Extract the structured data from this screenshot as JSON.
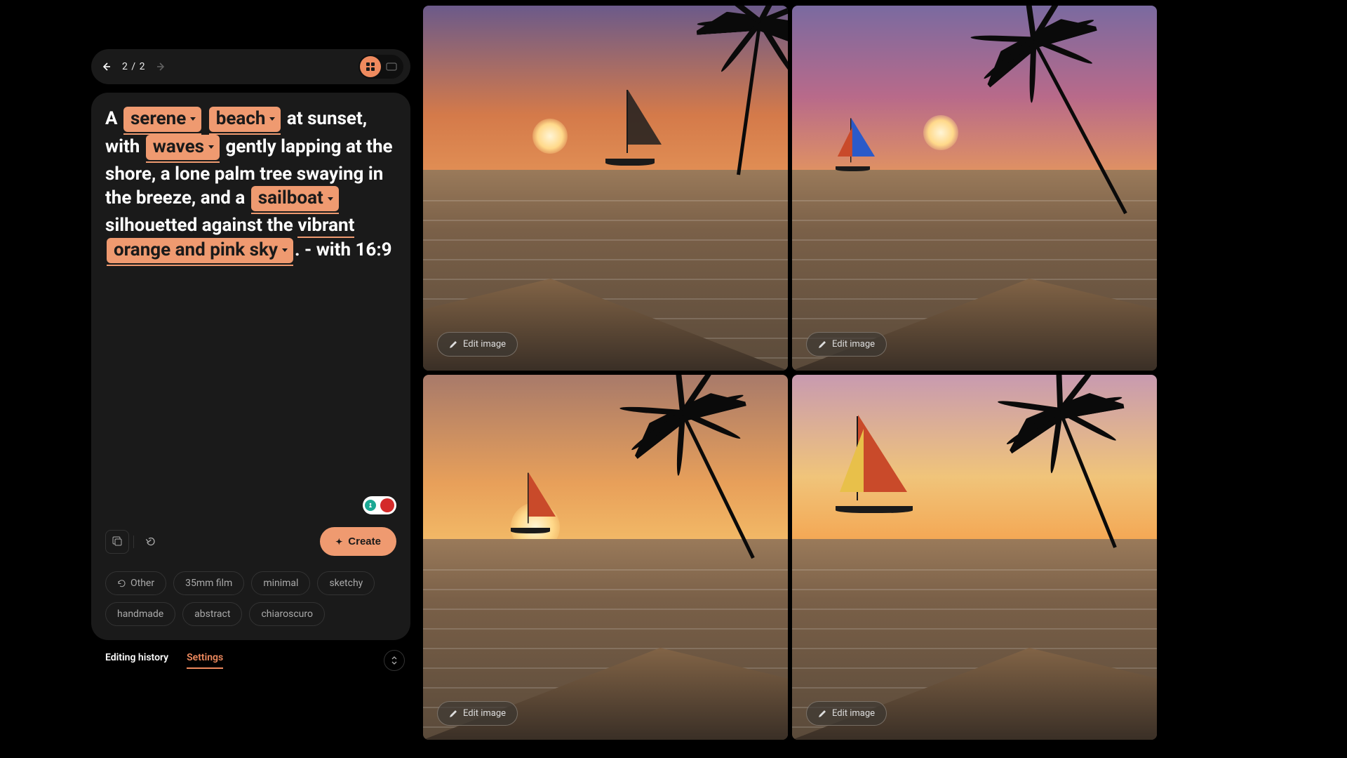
{
  "nav": {
    "page_indicator": "2 / 2"
  },
  "prompt": {
    "t1": "A ",
    "chip_serene": "serene",
    "chip_beach": "beach",
    "t2": " at sunset, with ",
    "chip_waves": "waves",
    "t3": " gently lapping at the shore, a lone palm tree swaying in the breeze, and a ",
    "chip_sailboat": "sailboat",
    "t4": " silhouetted against the ",
    "underline_vibrant": "vibrant",
    "chip_sky": "orange and pink sky",
    "t5": ". - with 16:9"
  },
  "create_label": "Create",
  "styles": {
    "other": "Other",
    "s1": "35mm film",
    "s2": "minimal",
    "s3": "sketchy",
    "s4": "handmade",
    "s5": "abstract",
    "s6": "chiaroscuro"
  },
  "tabs": {
    "history": "Editing history",
    "settings": "Settings"
  },
  "edit_label": "Edit image",
  "colors": {
    "accent": "#ef8a5e"
  }
}
